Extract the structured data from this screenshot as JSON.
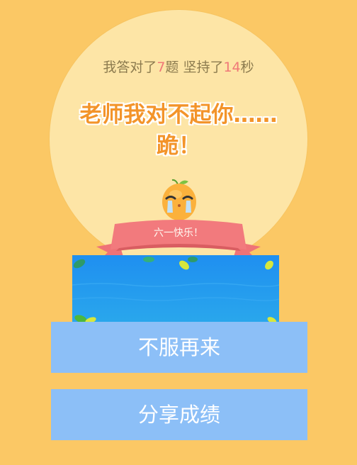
{
  "result": {
    "prefix": "我答对了",
    "questions": "7",
    "mid": "题 坚持了",
    "seconds": "14",
    "suffix": "秒"
  },
  "message": {
    "line1": "老师我对不起你……",
    "line2": "跪！"
  },
  "banner": {
    "label": "六一快乐！"
  },
  "buttons": {
    "retry": "不服再来",
    "share": "分享成绩"
  },
  "colors": {
    "background": "#fbc865",
    "circle": "#fde5a6",
    "button": "#8cbff7",
    "highlight": "#f07878",
    "title": "#f3942a"
  }
}
